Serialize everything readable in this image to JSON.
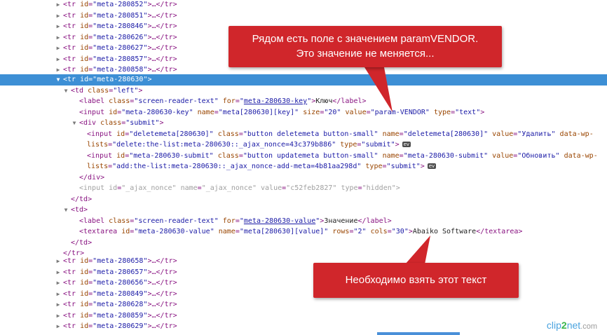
{
  "collapsed_rows_top": [
    {
      "id": "meta-280852"
    },
    {
      "id": "meta-280851"
    },
    {
      "id": "meta-280846"
    },
    {
      "id": "meta-280626"
    },
    {
      "id": "meta-280627"
    },
    {
      "id": "meta-280857"
    },
    {
      "id": "meta-280858"
    }
  ],
  "selected_row": {
    "id": "meta-280630"
  },
  "td_left": {
    "class": "left"
  },
  "label_key": {
    "class": "screen-reader-text",
    "for": "meta-280630-key",
    "text": "Ключ"
  },
  "input_key": {
    "id": "meta-280630-key",
    "name": "meta[280630][key]",
    "size": "20",
    "value": "param-VENDOR",
    "type": "text"
  },
  "div_submit": {
    "class": "submit"
  },
  "input_delete": {
    "id": "deletemeta[280630]",
    "class": "button deletemeta button-small",
    "name": "deletemeta[280630]",
    "value": "Удалить",
    "data_attr_start": "data-wp-",
    "data_attr_end": "lists",
    "data_value": "delete:the-list:meta-280630::_ajax_nonce=43c379b886",
    "type": "submit"
  },
  "input_update": {
    "id": "meta-280630-submit",
    "class": "button updatemeta button-small",
    "name": "meta-280630-submit",
    "value": "Обновить",
    "data_attr_start": "data-wp-",
    "data_attr_end": "lists",
    "data_value": "add:the-list:meta-280630::_ajax_nonce-add-meta=4b81aa298d",
    "type": "submit"
  },
  "input_nonce": {
    "id": "_ajax_nonce",
    "name": "_ajax_nonce",
    "value": "c52feb2827",
    "type": "hidden"
  },
  "label_value": {
    "class": "screen-reader-text",
    "for": "meta-280630-value",
    "text": "Значение"
  },
  "textarea_value": {
    "id": "meta-280630-value",
    "name": "meta[280630][value]",
    "rows": "2",
    "cols": "30",
    "text": "Abaiko Software"
  },
  "collapsed_rows_bottom": [
    {
      "id": "meta-280658"
    },
    {
      "id": "meta-280657"
    },
    {
      "id": "meta-280656"
    },
    {
      "id": "meta-280849"
    },
    {
      "id": "meta-280628"
    },
    {
      "id": "meta-280859"
    },
    {
      "id": "meta-280629"
    }
  ],
  "ev_badge": "ev",
  "callout_top": {
    "line1": "Рядом есть поле с значением paramVENDOR.",
    "line2": "Это значение не меняется..."
  },
  "callout_bottom": {
    "text": "Необходимо взять этот текст"
  },
  "watermark": {
    "part1": "clip",
    "part2": "2",
    "part3": "net",
    "part4": ".com"
  },
  "colors": {
    "selection": "#3d8fd5",
    "callout": "#d0262b",
    "tag": "#881280",
    "attr_name": "#994500",
    "attr_value": "#1a1aa6"
  }
}
